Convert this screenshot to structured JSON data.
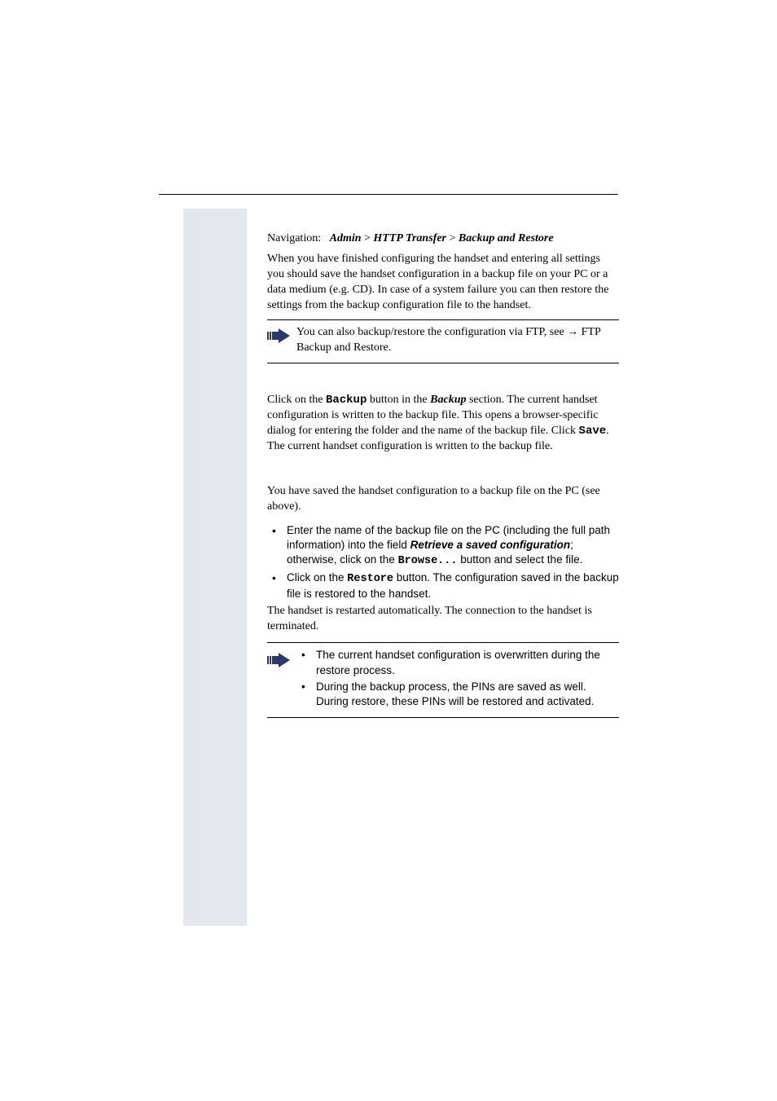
{
  "nav": {
    "label": "Navigation:",
    "crumb1": "Admin",
    "sep": ">",
    "crumb2": "HTTP Transfer",
    "crumb3": "Backup and Restore"
  },
  "intro": "When you have finished configuring the handset and entering all settings you should save the handset configuration in a backup file on your PC or a data medium (e.g. CD). In case of a system failure you can then restore the settings from the backup configuration file to the handset.",
  "note1": {
    "pre": "You can also backup/restore the configuration via FTP, see ",
    "arrow": "→",
    "post": " FTP Backup and Restore."
  },
  "backup": {
    "t1": "Click on the ",
    "btn": "Backup",
    "t2": " button in the ",
    "section": "Backup",
    "t3": " section. The current handset configuration is written to the backup file. This opens a browser-specific dialog for entering the folder and the name of the backup file. Click ",
    "save": "Save",
    "t4": ". The current handset configuration is written to the backup file."
  },
  "restore": {
    "intro": "You have saved the handset configuration to a backup file on the PC (see above).",
    "li1": {
      "t1": "Enter the name of the backup file on the PC (including the full path information) into the field ",
      "field": "Retrieve a saved configuration",
      "t2": "; otherwise, click on the ",
      "browse": "Browse...",
      "t3": " button and select the file."
    },
    "li2": {
      "t1": "Click on the ",
      "btn": "Restore",
      "t2": " button. The configuration saved in the backup file is restored to the handset."
    },
    "after": "The handset is restarted automatically. The connection to the handset is terminated."
  },
  "note2": {
    "li1": "The current handset configuration is overwritten during the restore process.",
    "li2": "During the backup process, the PINs are saved as well. During restore, these PINs will be restored and activated."
  }
}
